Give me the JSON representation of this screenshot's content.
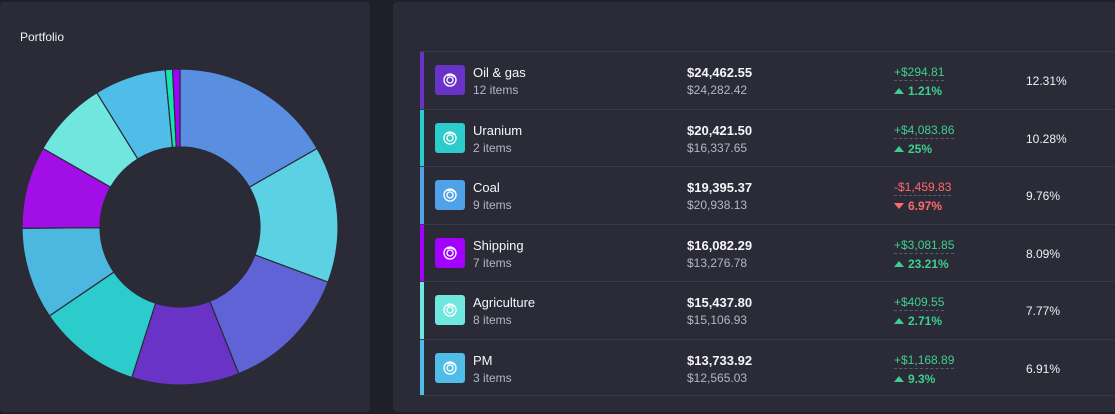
{
  "portfolio": {
    "title": "Portfolio"
  },
  "colors": {
    "positive": "#3ecf8e",
    "negative": "#ff6b6b"
  },
  "chart_data": {
    "type": "pie",
    "title": "Portfolio",
    "hole": true,
    "series": [
      {
        "name": "Oil & gas",
        "value": 12.31,
        "color": "#5a8ee0"
      },
      {
        "name": "Uranium",
        "value": 10.28,
        "color": "#5bd1e3"
      },
      {
        "name": "Coal",
        "value": 9.76,
        "color": "#5f63d6"
      },
      {
        "name": "Shipping",
        "value": 8.09,
        "color": "#6a33c8"
      },
      {
        "name": "Agriculture",
        "value": 7.77,
        "color": "#2ccccc"
      },
      {
        "name": "PM",
        "value": 6.91,
        "color": "#4cb8e0"
      },
      {
        "name": "",
        "value": 6.2,
        "color": "#a10ee6"
      },
      {
        "name": "",
        "value": 5.8,
        "color": "#6fe7df"
      },
      {
        "name": "",
        "value": 5.4,
        "color": "#4fbde8"
      },
      {
        "name": "",
        "value": 0.55,
        "color": "#16e2b2"
      },
      {
        "name": "",
        "value": 0.55,
        "color": "#a200ff"
      }
    ]
  },
  "rows": [
    {
      "name": "Oil & gas",
      "items": "12 items",
      "value_now": "$24,462.55",
      "value_prev": "$24,282.42",
      "change_abs": "+$294.81",
      "change_pct": "1.21%",
      "direction": "up",
      "share": "12.31%",
      "accent": "#6a33c8",
      "icon_bg": "#6a33c8",
      "icon": "coin-icon"
    },
    {
      "name": "Uranium",
      "items": "2 items",
      "value_now": "$20,421.50",
      "value_prev": "$16,337.65",
      "change_abs": "+$4,083.86",
      "change_pct": "25%",
      "direction": "up",
      "share": "10.28%",
      "accent": "#2ccccc",
      "icon_bg": "#2ccccc",
      "icon": "coin-icon"
    },
    {
      "name": "Coal",
      "items": "9 items",
      "value_now": "$19,395.37",
      "value_prev": "$20,938.13",
      "change_abs": "-$1,459.83",
      "change_pct": "6.97%",
      "direction": "down",
      "share": "9.76%",
      "accent": "#4fa2e8",
      "icon_bg": "#4fa2e8",
      "icon": "coin-icon"
    },
    {
      "name": "Shipping",
      "items": "7 items",
      "value_now": "$16,082.29",
      "value_prev": "$13,276.78",
      "change_abs": "+$3,081.85",
      "change_pct": "23.21%",
      "direction": "up",
      "share": "8.09%",
      "accent": "#a200ff",
      "icon_bg": "#a200ff",
      "icon": "coin-icon"
    },
    {
      "name": "Agriculture",
      "items": "8 items",
      "value_now": "$15,437.80",
      "value_prev": "$15,106.93",
      "change_abs": "+$409.55",
      "change_pct": "2.71%",
      "direction": "up",
      "share": "7.77%",
      "accent": "#6fe7df",
      "icon_bg": "#6fe7df",
      "icon": "coin-icon"
    },
    {
      "name": "PM",
      "items": "3 items",
      "value_now": "$13,733.92",
      "value_prev": "$12,565.03",
      "change_abs": "+$1,168.89",
      "change_pct": "9.3%",
      "direction": "up",
      "share": "6.91%",
      "accent": "#4fbde8",
      "icon_bg": "#4fbde8",
      "icon": "coin-icon"
    }
  ]
}
